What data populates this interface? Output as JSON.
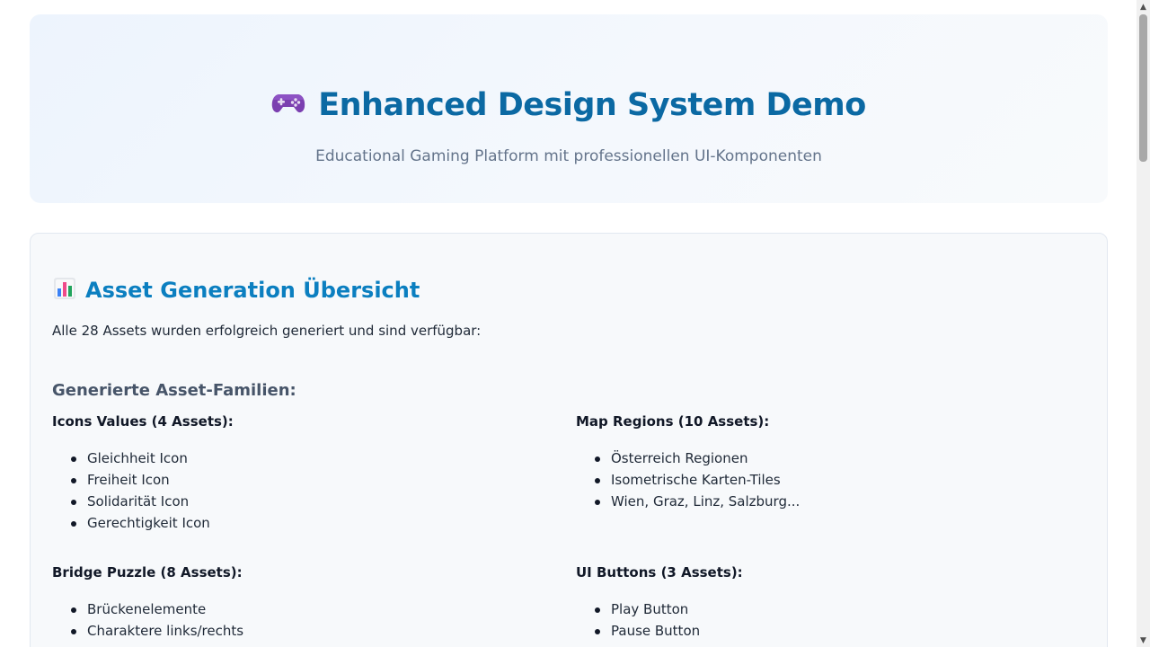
{
  "hero": {
    "icon": "gamepad-icon",
    "title": "Enhanced Design System Demo",
    "subtitle": "Educational Gaming Platform mit professionellen UI-Komponenten"
  },
  "overview": {
    "icon": "bar-chart-icon",
    "title": "Asset Generation Übersicht",
    "intro": "Alle 28 Assets wurden erfolgreich generiert und sind verfügbar:",
    "families_heading": "Generierte Asset-Familien:",
    "families": [
      {
        "title": "Icons Values (4 Assets):",
        "items": [
          "Gleichheit Icon",
          "Freiheit Icon",
          "Solidarität Icon",
          "Gerechtigkeit Icon"
        ]
      },
      {
        "title": "Map Regions (10 Assets):",
        "items": [
          "Österreich Regionen",
          "Isometrische Karten-Tiles",
          "Wien, Graz, Linz, Salzburg..."
        ]
      },
      {
        "title": "Bridge Puzzle (8 Assets):",
        "items": [
          "Brückenelemente",
          "Charaktere links/rechts"
        ]
      },
      {
        "title": "UI Buttons (3 Assets):",
        "items": [
          "Play Button",
          "Pause Button"
        ]
      }
    ]
  },
  "colors": {
    "title": "#0b69a3",
    "section_title": "#0b7fc0",
    "hero_bg": "#edf4fd",
    "card_bg": "#f7f9fb"
  }
}
